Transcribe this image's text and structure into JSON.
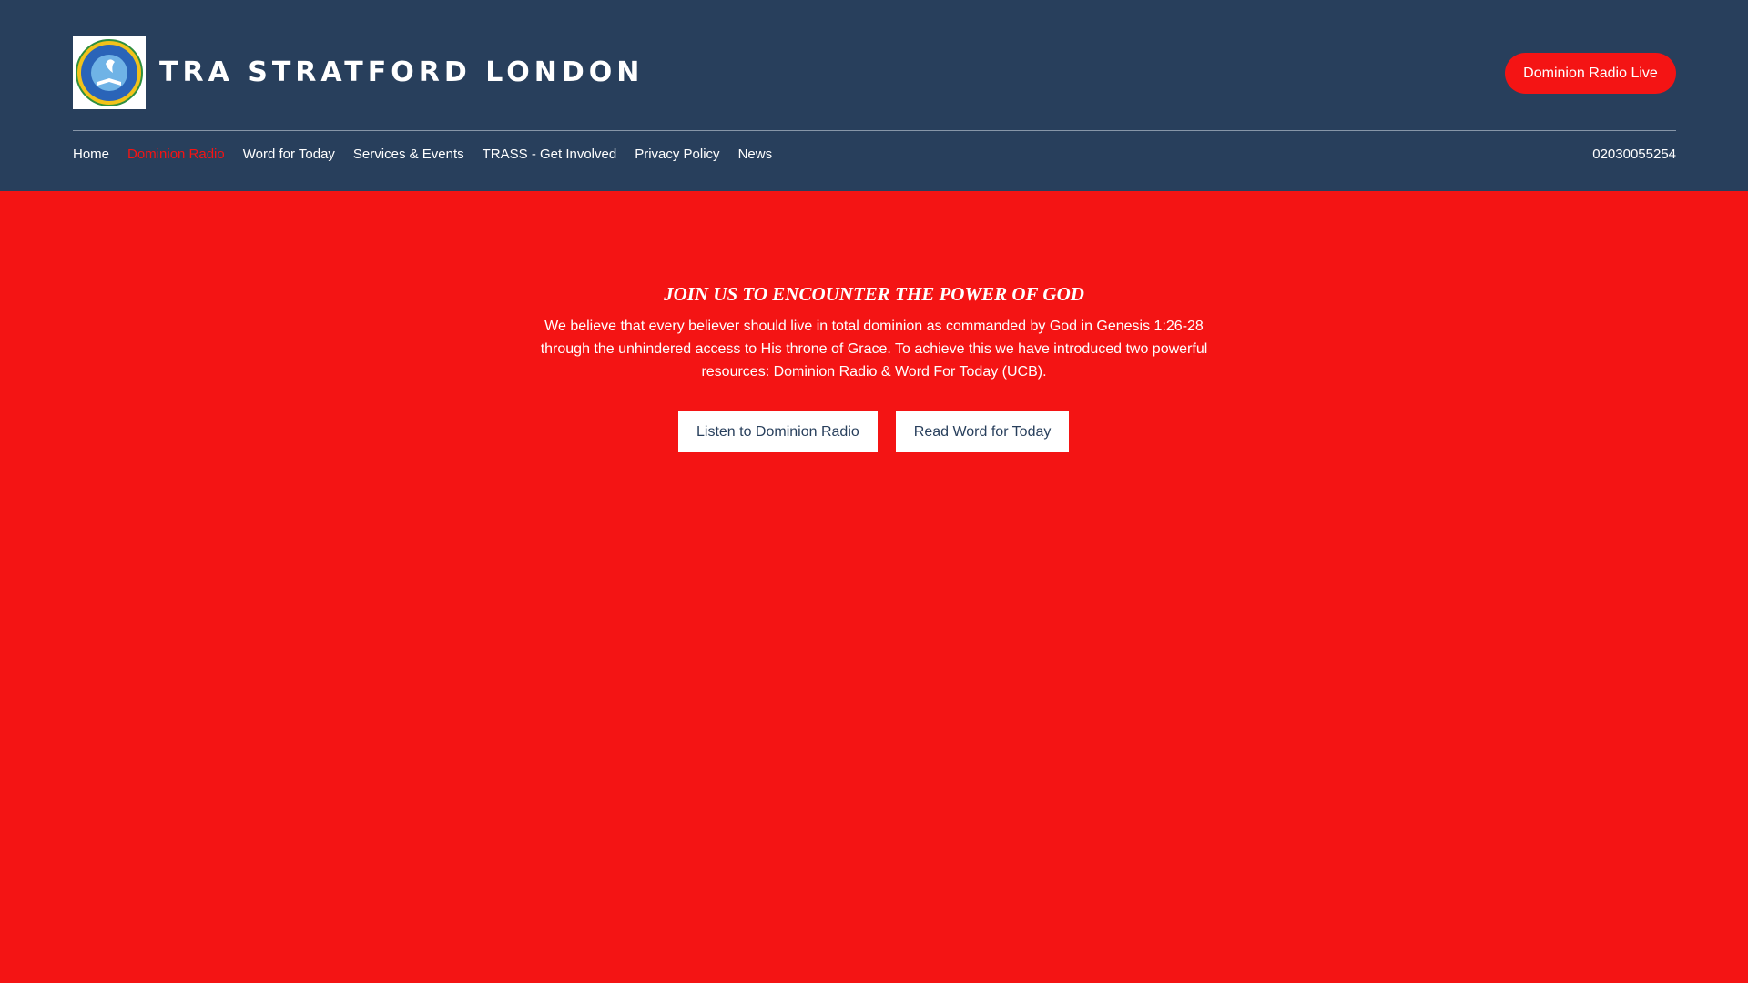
{
  "header": {
    "site_title": "TRA STRATFORD LONDON",
    "live_button": "Dominion Radio Live",
    "phone": "02030055254"
  },
  "nav": {
    "items": [
      {
        "label": "Home"
      },
      {
        "label": "Dominion Radio",
        "active": true
      },
      {
        "label": "Word for Today"
      },
      {
        "label": "Services & Events"
      },
      {
        "label": "TRASS - Get Involved"
      },
      {
        "label": "Privacy Policy"
      },
      {
        "label": "News"
      }
    ]
  },
  "hero": {
    "title": "JOIN US TO ENCOUNTER THE POWER OF GOD",
    "body": "We believe that every believer should live in total dominion as commanded by God in Genesis 1:26-28 through the unhindered access to His throne of Grace. To achieve this we have introduced two powerful resources: Dominion Radio & Word For Today (UCB).",
    "buttons": {
      "listen": "Listen to Dominion Radio",
      "read": "Read Word for Today"
    }
  },
  "colors": {
    "header_bg": "#283f5c",
    "accent_red": "#f41414",
    "white": "#ffffff"
  },
  "icons": {
    "logo": "church-emblem-logo"
  }
}
